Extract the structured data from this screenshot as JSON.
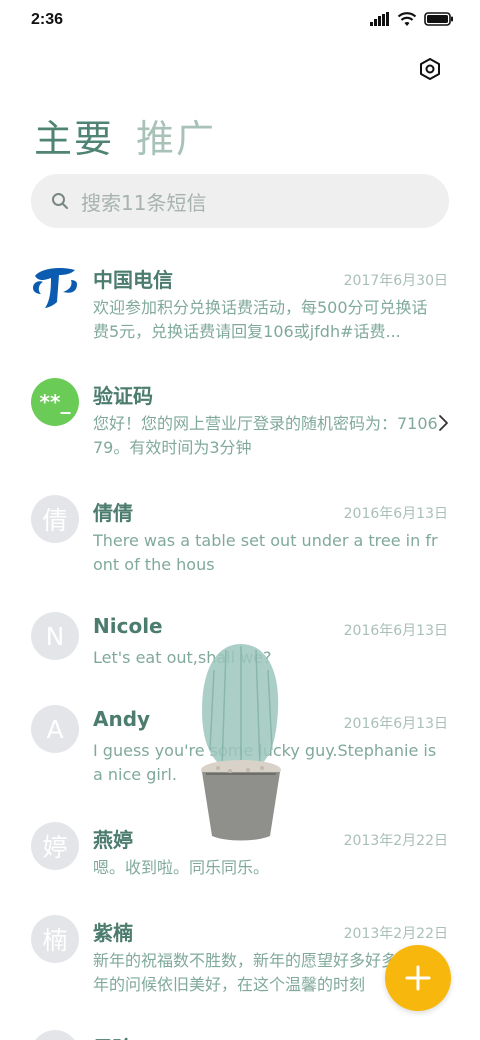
{
  "status_bar": {
    "time": "2:36"
  },
  "tabs": [
    {
      "label": "主要",
      "active": true
    },
    {
      "label": "推广",
      "active": false
    }
  ],
  "search": {
    "placeholder": "搜索11条短信"
  },
  "messages": [
    {
      "sender": "中国电信",
      "date": "2017年6月30日",
      "snippet": "欢迎参加积分兑换话费活动，每500分可兑换话费5元，兑换话费请回复106或jfdh#话费...",
      "avatar": "telecom-logo"
    },
    {
      "sender": "验证码",
      "date": "",
      "snippet": "您好！您的网上营业厅登录的随机密码为：710679。有效时间为3分钟",
      "avatar_text": "**_",
      "avatar": "verify-code"
    },
    {
      "sender": "倩倩",
      "date": "2016年6月13日",
      "snippet": "There was a table set out under a tree in front of the hous",
      "avatar_text": "倩"
    },
    {
      "sender": "Nicole",
      "date": "2016年6月13日",
      "snippet": "Let's eat out,shall we?",
      "avatar_text": "N"
    },
    {
      "sender": "Andy",
      "date": "2016年6月13日",
      "snippet": "I guess you're some lucky guy.Stephanie is a nice girl.",
      "avatar_text": "A"
    },
    {
      "sender": "燕婷",
      "date": "2013年2月22日",
      "snippet": "嗯。收到啦。同乐同乐。",
      "avatar_text": "婷"
    },
    {
      "sender": "紫楠",
      "date": "2013年2月22日",
      "snippet": "新年的祝福数不胜数，新年的愿望好多好多，新年的问候依旧美好，在这个温馨的时刻",
      "avatar_text": "楠"
    },
    {
      "sender": "子玲",
      "date": "",
      "snippet": "",
      "avatar_text": ""
    }
  ],
  "colors": {
    "accent": "#4f8474",
    "fab": "#f8b70c",
    "verify_avatar": "#6acb57",
    "telecom_blue": "#0b5bb0"
  },
  "icons": {
    "settings": "settings-hex-icon",
    "search": "search-icon",
    "fab": "plus-icon",
    "chevron": "chevron-right-icon"
  }
}
